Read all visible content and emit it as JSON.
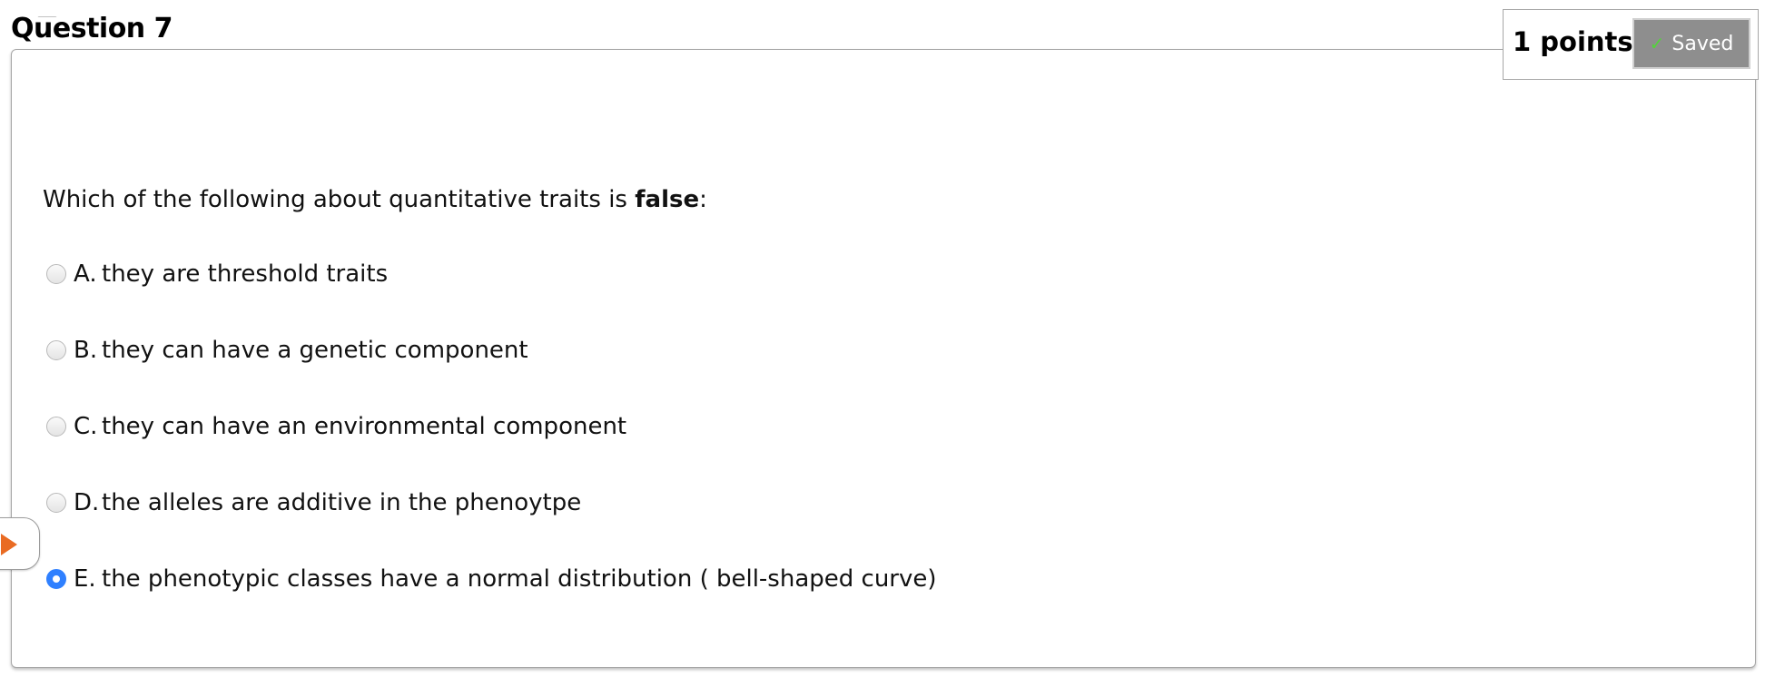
{
  "question": {
    "title": "Question 7",
    "points": "1 points",
    "saved_label": "Saved",
    "prompt_prefix": "Which of the following about quantitative traits is ",
    "prompt_emphasis": "false",
    "prompt_suffix": ":",
    "options": [
      {
        "letter": "A.",
        "text": "they are threshold traits",
        "selected": false
      },
      {
        "letter": "B.",
        "text": "they can have a genetic component",
        "selected": false
      },
      {
        "letter": "C.",
        "text": "they can have an environmental component",
        "selected": false
      },
      {
        "letter": "D.",
        "text": "the alleles are additive in the phenoytpe",
        "selected": false
      },
      {
        "letter": "E.",
        "text": "the phenotypic classes have a normal distribution ( bell-shaped curve)",
        "selected": true
      }
    ]
  },
  "icons": {
    "saved_status": "check-icon",
    "navigation": "play-icon"
  },
  "colors": {
    "saved_button_bg": "#8e8e8e",
    "check_color": "#54d33c",
    "selected_radio": "#2f80ff",
    "navigation_arrow": "#e96b23"
  }
}
